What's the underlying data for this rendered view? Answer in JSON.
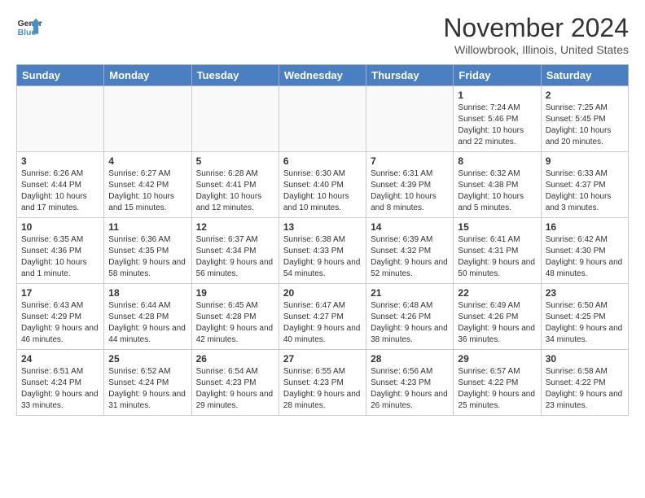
{
  "header": {
    "logo_line1": "General",
    "logo_line2": "Blue",
    "title": "November 2024",
    "location": "Willowbrook, Illinois, United States"
  },
  "weekdays": [
    "Sunday",
    "Monday",
    "Tuesday",
    "Wednesday",
    "Thursday",
    "Friday",
    "Saturday"
  ],
  "weeks": [
    [
      {
        "day": "",
        "info": ""
      },
      {
        "day": "",
        "info": ""
      },
      {
        "day": "",
        "info": ""
      },
      {
        "day": "",
        "info": ""
      },
      {
        "day": "",
        "info": ""
      },
      {
        "day": "1",
        "info": "Sunrise: 7:24 AM\nSunset: 5:46 PM\nDaylight: 10 hours and 22 minutes."
      },
      {
        "day": "2",
        "info": "Sunrise: 7:25 AM\nSunset: 5:45 PM\nDaylight: 10 hours and 20 minutes."
      }
    ],
    [
      {
        "day": "3",
        "info": "Sunrise: 6:26 AM\nSunset: 4:44 PM\nDaylight: 10 hours and 17 minutes."
      },
      {
        "day": "4",
        "info": "Sunrise: 6:27 AM\nSunset: 4:42 PM\nDaylight: 10 hours and 15 minutes."
      },
      {
        "day": "5",
        "info": "Sunrise: 6:28 AM\nSunset: 4:41 PM\nDaylight: 10 hours and 12 minutes."
      },
      {
        "day": "6",
        "info": "Sunrise: 6:30 AM\nSunset: 4:40 PM\nDaylight: 10 hours and 10 minutes."
      },
      {
        "day": "7",
        "info": "Sunrise: 6:31 AM\nSunset: 4:39 PM\nDaylight: 10 hours and 8 minutes."
      },
      {
        "day": "8",
        "info": "Sunrise: 6:32 AM\nSunset: 4:38 PM\nDaylight: 10 hours and 5 minutes."
      },
      {
        "day": "9",
        "info": "Sunrise: 6:33 AM\nSunset: 4:37 PM\nDaylight: 10 hours and 3 minutes."
      }
    ],
    [
      {
        "day": "10",
        "info": "Sunrise: 6:35 AM\nSunset: 4:36 PM\nDaylight: 10 hours and 1 minute."
      },
      {
        "day": "11",
        "info": "Sunrise: 6:36 AM\nSunset: 4:35 PM\nDaylight: 9 hours and 58 minutes."
      },
      {
        "day": "12",
        "info": "Sunrise: 6:37 AM\nSunset: 4:34 PM\nDaylight: 9 hours and 56 minutes."
      },
      {
        "day": "13",
        "info": "Sunrise: 6:38 AM\nSunset: 4:33 PM\nDaylight: 9 hours and 54 minutes."
      },
      {
        "day": "14",
        "info": "Sunrise: 6:39 AM\nSunset: 4:32 PM\nDaylight: 9 hours and 52 minutes."
      },
      {
        "day": "15",
        "info": "Sunrise: 6:41 AM\nSunset: 4:31 PM\nDaylight: 9 hours and 50 minutes."
      },
      {
        "day": "16",
        "info": "Sunrise: 6:42 AM\nSunset: 4:30 PM\nDaylight: 9 hours and 48 minutes."
      }
    ],
    [
      {
        "day": "17",
        "info": "Sunrise: 6:43 AM\nSunset: 4:29 PM\nDaylight: 9 hours and 46 minutes."
      },
      {
        "day": "18",
        "info": "Sunrise: 6:44 AM\nSunset: 4:28 PM\nDaylight: 9 hours and 44 minutes."
      },
      {
        "day": "19",
        "info": "Sunrise: 6:45 AM\nSunset: 4:28 PM\nDaylight: 9 hours and 42 minutes."
      },
      {
        "day": "20",
        "info": "Sunrise: 6:47 AM\nSunset: 4:27 PM\nDaylight: 9 hours and 40 minutes."
      },
      {
        "day": "21",
        "info": "Sunrise: 6:48 AM\nSunset: 4:26 PM\nDaylight: 9 hours and 38 minutes."
      },
      {
        "day": "22",
        "info": "Sunrise: 6:49 AM\nSunset: 4:26 PM\nDaylight: 9 hours and 36 minutes."
      },
      {
        "day": "23",
        "info": "Sunrise: 6:50 AM\nSunset: 4:25 PM\nDaylight: 9 hours and 34 minutes."
      }
    ],
    [
      {
        "day": "24",
        "info": "Sunrise: 6:51 AM\nSunset: 4:24 PM\nDaylight: 9 hours and 33 minutes."
      },
      {
        "day": "25",
        "info": "Sunrise: 6:52 AM\nSunset: 4:24 PM\nDaylight: 9 hours and 31 minutes."
      },
      {
        "day": "26",
        "info": "Sunrise: 6:54 AM\nSunset: 4:23 PM\nDaylight: 9 hours and 29 minutes."
      },
      {
        "day": "27",
        "info": "Sunrise: 6:55 AM\nSunset: 4:23 PM\nDaylight: 9 hours and 28 minutes."
      },
      {
        "day": "28",
        "info": "Sunrise: 6:56 AM\nSunset: 4:23 PM\nDaylight: 9 hours and 26 minutes."
      },
      {
        "day": "29",
        "info": "Sunrise: 6:57 AM\nSunset: 4:22 PM\nDaylight: 9 hours and 25 minutes."
      },
      {
        "day": "30",
        "info": "Sunrise: 6:58 AM\nSunset: 4:22 PM\nDaylight: 9 hours and 23 minutes."
      }
    ]
  ]
}
